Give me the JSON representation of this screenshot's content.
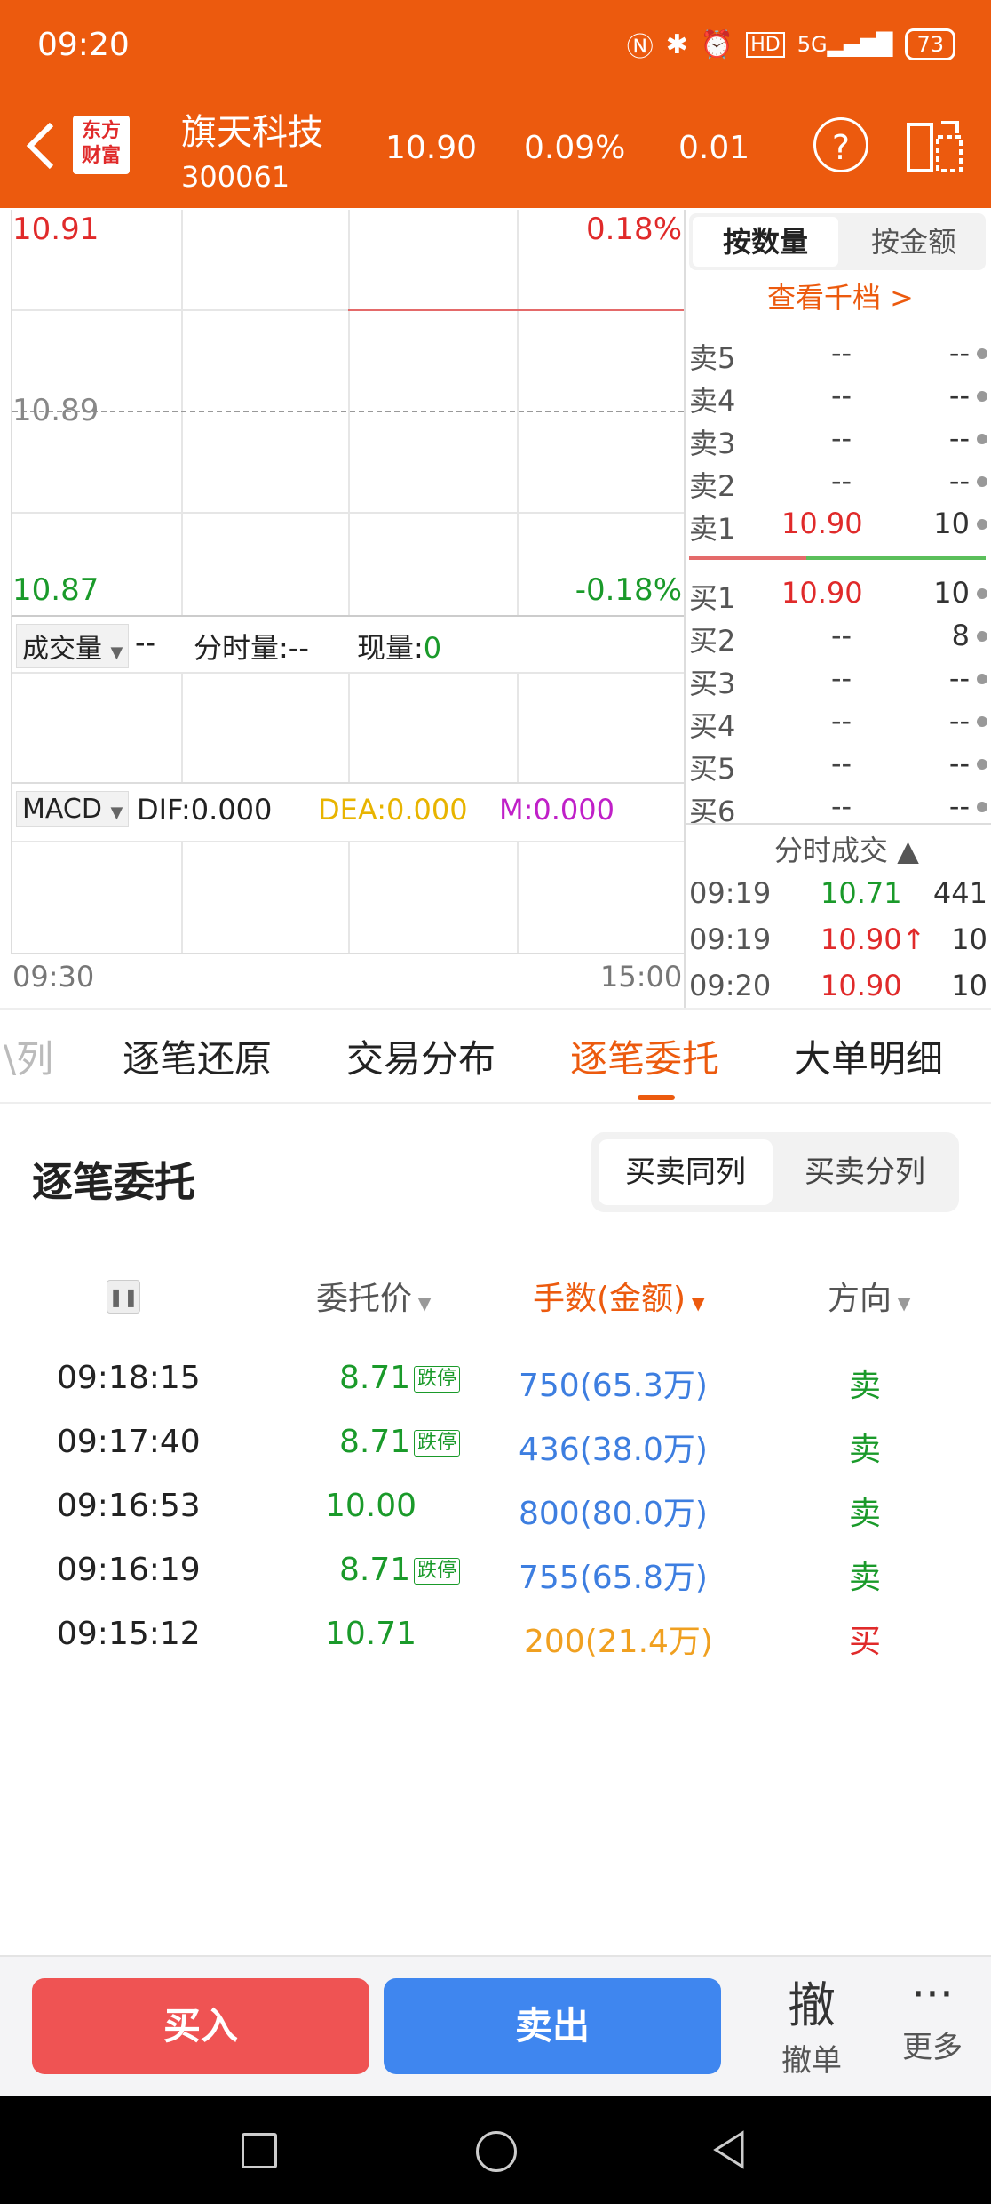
{
  "status_bar": {
    "time": "09:20",
    "battery": "73"
  },
  "header": {
    "logo_line1": "东方",
    "logo_line2": "财富",
    "stock_name": "旗天科技",
    "stock_code": "300061",
    "price": "10.90",
    "change_pct": "0.09%",
    "change": "0.01"
  },
  "chart": {
    "y_top": "10.91",
    "y_mid": "10.89",
    "y_bot": "10.87",
    "pct_top": "0.18%",
    "pct_bot": "-0.18%",
    "time_start": "09:30",
    "time_end": "15:00"
  },
  "volume_panel": {
    "selector": "成交量",
    "value": "--",
    "split_label": "分时量:--",
    "current_label": "现量:",
    "current_value": "0"
  },
  "macd_panel": {
    "selector": "MACD",
    "dif": "DIF:0.000",
    "dea": "DEA:0.000",
    "m": "M:0.000"
  },
  "orderbook": {
    "toggle_volume": "按数量",
    "toggle_amount": "按金额",
    "view_more": "查看千档 >",
    "sells": [
      {
        "label": "卖5",
        "price": "--",
        "qty": "--"
      },
      {
        "label": "卖4",
        "price": "--",
        "qty": "--"
      },
      {
        "label": "卖3",
        "price": "--",
        "qty": "--"
      },
      {
        "label": "卖2",
        "price": "--",
        "qty": "--"
      },
      {
        "label": "卖1",
        "price": "10.90",
        "qty": "10"
      }
    ],
    "buys": [
      {
        "label": "买1",
        "price": "10.90",
        "qty": "10"
      },
      {
        "label": "买2",
        "price": "--",
        "qty": "8"
      },
      {
        "label": "买3",
        "price": "--",
        "qty": "--"
      },
      {
        "label": "买4",
        "price": "--",
        "qty": "--"
      },
      {
        "label": "买5",
        "price": "--",
        "qty": "--"
      },
      {
        "label": "买6",
        "price": "--",
        "qty": "--"
      }
    ]
  },
  "ticks": {
    "title": "分时成交",
    "rows": [
      {
        "time": "09:19",
        "price": "10.71",
        "qty": "441"
      },
      {
        "time": "09:19",
        "price": "10.90↑",
        "qty": "10"
      },
      {
        "time": "09:20",
        "price": "10.90",
        "qty": "10"
      }
    ]
  },
  "tabs": [
    "\\列",
    "逐笔还原",
    "交易分布",
    "逐笔委托",
    "大单明细"
  ],
  "section": {
    "title": "逐笔委托",
    "seg_a": "买卖同列",
    "seg_b": "买卖分列"
  },
  "table": {
    "col_price": "委托价",
    "col_qty": "手数(金额)",
    "col_dir": "方向",
    "rows": [
      {
        "time": "09:18:15",
        "price": "8.71",
        "tag": "跌停",
        "qty": "750(65.3万)",
        "dir": "卖"
      },
      {
        "time": "09:17:40",
        "price": "8.71",
        "tag": "跌停",
        "qty": "436(38.0万)",
        "dir": "卖"
      },
      {
        "time": "09:16:53",
        "price": "10.00",
        "tag": "",
        "qty": "800(80.0万)",
        "dir": "卖"
      },
      {
        "time": "09:16:19",
        "price": "8.71",
        "tag": "跌停",
        "qty": "755(65.8万)",
        "dir": "卖"
      },
      {
        "time": "09:15:12",
        "price": "10.71",
        "tag": "",
        "qty": "200(21.4万)",
        "dir": "买"
      }
    ]
  },
  "bottom": {
    "buy": "买入",
    "sell": "卖出",
    "cancel_glyph": "撤",
    "cancel": "撤单",
    "more_glyph": "···",
    "more": "更多"
  },
  "colors": {
    "brand": "#ec5a0e",
    "red": "#e02a2a",
    "green": "#1a9a2a",
    "blue": "#3d7ee0"
  }
}
